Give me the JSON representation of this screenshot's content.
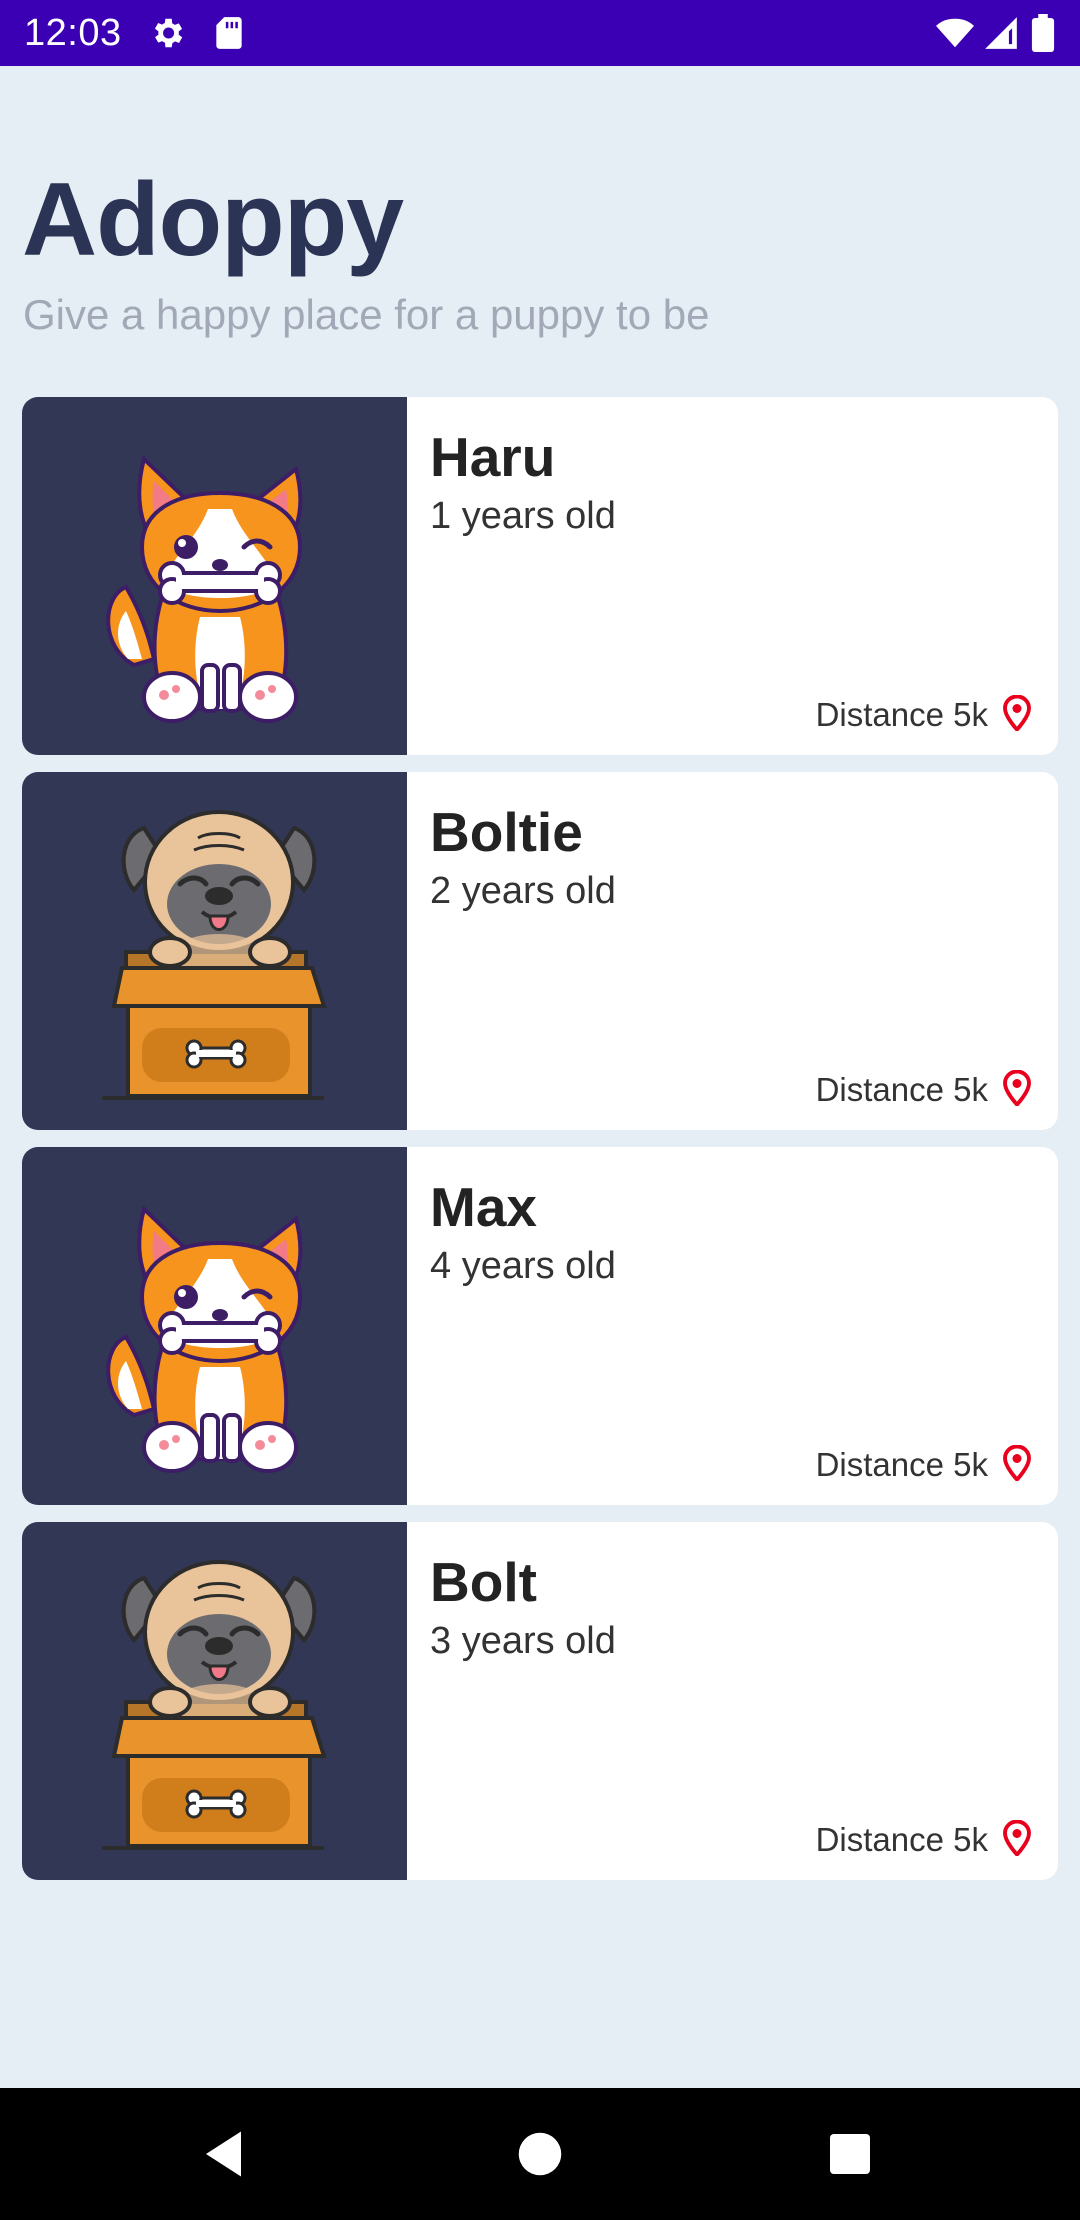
{
  "status_bar": {
    "time": "12:03",
    "background": "#3c00b4",
    "left_icons": [
      "gear-icon",
      "sd-card-icon"
    ],
    "right_icons": [
      "wifi-icon",
      "cellular-signal-icon",
      "battery-icon"
    ]
  },
  "header": {
    "title": "Adoppy",
    "subtitle": "Give a happy place for a puppy to be"
  },
  "pets": [
    {
      "name": "Haru",
      "age": "1 years old",
      "distance": "Distance 5k",
      "illustration": "corgi-with-bone"
    },
    {
      "name": "Boltie",
      "age": "2 years old",
      "distance": "Distance 5k",
      "illustration": "pug-in-box"
    },
    {
      "name": "Max",
      "age": "4 years old",
      "distance": "Distance 5k",
      "illustration": "corgi-with-bone"
    },
    {
      "name": "Bolt",
      "age": "3 years old",
      "distance": "Distance 5k",
      "illustration": "pug-in-box"
    }
  ],
  "colors": {
    "background": "#e5edf5",
    "title": "#2c3456",
    "subtitle": "#a3a8b6",
    "card_image_bg": "#323755",
    "location_pin": "#e8001c"
  },
  "nav_bar": {
    "buttons": [
      "back-icon",
      "home-icon",
      "recents-icon"
    ]
  }
}
